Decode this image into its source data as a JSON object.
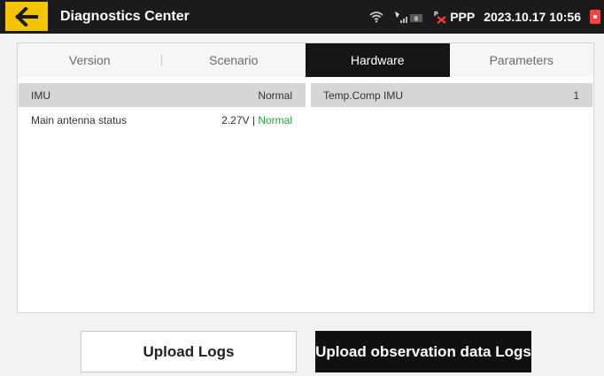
{
  "topbar": {
    "title": "Diagnostics Center",
    "ppp_label": "PPP",
    "signal_count": "0",
    "clock": "2023.10.17 10:56",
    "icons": {
      "back": "arrow-left-icon",
      "wifi": "wifi-icon",
      "signal": "satellite-signal-icon",
      "ppp": "ppp-error-icon",
      "battery": "battery-low-icon"
    },
    "colors": {
      "back_button": "#f5c400",
      "battery": "#ff4040",
      "bar": "#1b1b1b"
    }
  },
  "tabs": [
    {
      "label": "Version",
      "active": false
    },
    {
      "label": "Scenario",
      "active": false
    },
    {
      "label": "Hardware",
      "active": true
    },
    {
      "label": "Parameters",
      "active": false
    }
  ],
  "hardware": {
    "left": [
      {
        "label": "IMU",
        "value": "Normal"
      },
      {
        "label": "Main antenna status",
        "value_prefix": "2.27V | ",
        "value_status": "Normal"
      }
    ],
    "right": [
      {
        "label": "Temp.Comp IMU",
        "value": "1"
      }
    ],
    "colors": {
      "status_ok": "#1ea832"
    }
  },
  "buttons": {
    "upload_logs": "Upload Logs",
    "upload_observation": "Upload observation data Logs"
  }
}
